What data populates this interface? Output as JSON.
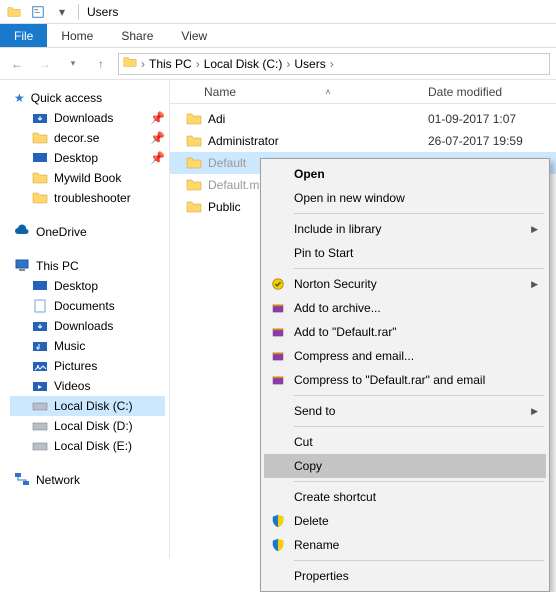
{
  "titlebar": {
    "title": "Users"
  },
  "ribbon": {
    "file": "File",
    "home": "Home",
    "share": "Share",
    "view": "View"
  },
  "breadcrumb": {
    "items": [
      "This PC",
      "Local Disk (C:)",
      "Users"
    ]
  },
  "tree": {
    "quick_access": "Quick access",
    "quick_items": [
      "Downloads",
      "decor.se",
      "Desktop",
      "Mywild Book",
      "troubleshooter"
    ],
    "onedrive": "OneDrive",
    "this_pc": "This PC",
    "pc_items": [
      "Desktop",
      "Documents",
      "Downloads",
      "Music",
      "Pictures",
      "Videos",
      "Local Disk (C:)",
      "Local Disk (D:)",
      "Local Disk (E:)"
    ],
    "network": "Network"
  },
  "list": {
    "col_name": "Name",
    "col_date": "Date modified",
    "rows": [
      {
        "name": "Adi",
        "date": "01-09-2017 1:07"
      },
      {
        "name": "Administrator",
        "date": "26-07-2017 19:59"
      },
      {
        "name": "Default",
        "date": ""
      },
      {
        "name": "Default.mi",
        "date": ""
      },
      {
        "name": "Public",
        "date": ""
      }
    ]
  },
  "menu": {
    "open": "Open",
    "open_new": "Open in new window",
    "include": "Include in library",
    "pin": "Pin to Start",
    "norton": "Norton Security",
    "add_archive": "Add to archive...",
    "add_default": "Add to \"Default.rar\"",
    "compress_email": "Compress and email...",
    "compress_default": "Compress to \"Default.rar\" and email",
    "send_to": "Send to",
    "cut": "Cut",
    "copy": "Copy",
    "shortcut": "Create shortcut",
    "delete": "Delete",
    "rename": "Rename",
    "properties": "Properties"
  }
}
